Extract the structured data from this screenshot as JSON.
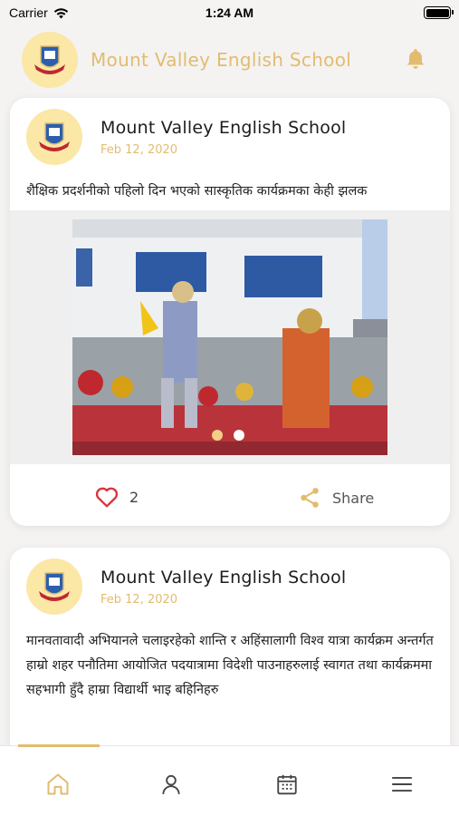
{
  "status_bar": {
    "carrier": "Carrier",
    "time": "1:24 AM"
  },
  "header": {
    "title": "Mount Valley English School",
    "logo_icon": "school-crest-icon",
    "bell_icon": "bell-icon"
  },
  "colors": {
    "accent": "#e2bc6e",
    "like_red": "#d9363e",
    "text": "#1d1d1d",
    "dot_active": "#f3cf86"
  },
  "posts": [
    {
      "author": "Mount Valley English School",
      "date": "Feb 12, 2020",
      "text": "शैक्षिक प्रदर्शनीको पहिलो दिन भएको सास्कृतिक कार्यक्रमका केही झलक",
      "likes": "2",
      "share_label": "Share",
      "carousel": {
        "count": 2,
        "active_index": 0
      }
    },
    {
      "author": "Mount Valley English School",
      "date": "Feb 12, 2020",
      "text": "मानवतावादी अभियानले चलाइरहेको शान्ति र अहिंसालागी विश्व यात्रा कार्यक्रम अन्तर्गत हाम्रो शहर पनौतिमा आयोजित पदयात्रामा विदेशी पाउनाहरुलाई स्वागत तथा कार्यक्रममा सहभागी हुँदै हाम्रा विद्यार्थी भाइ बहिनिहरु"
    }
  ],
  "tab_bar": {
    "items": [
      "home-icon",
      "profile-icon",
      "calendar-icon",
      "menu-icon"
    ],
    "active": "home-icon"
  }
}
